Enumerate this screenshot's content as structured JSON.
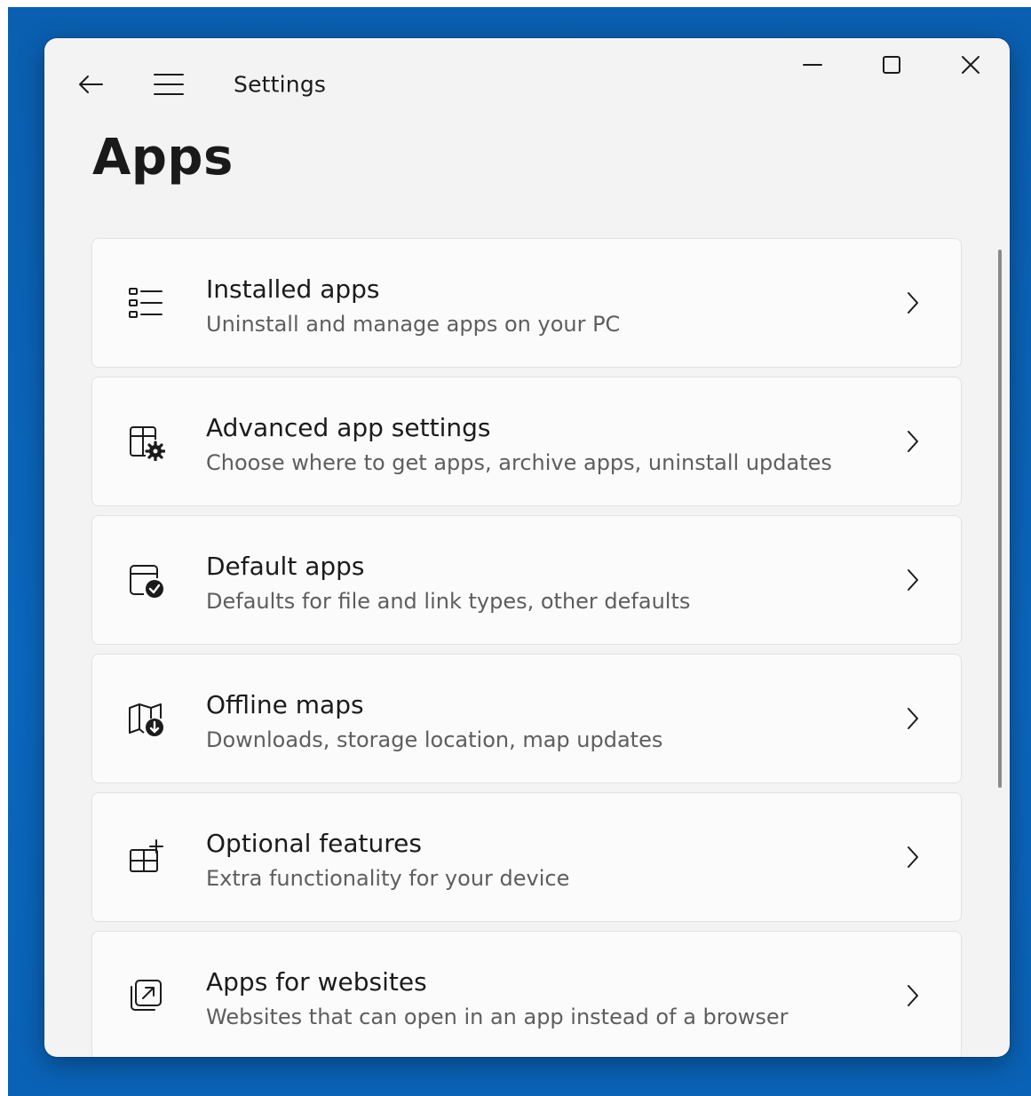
{
  "window": {
    "title": "Settings",
    "back_icon": "back-arrow-icon",
    "menu_icon": "hamburger-menu-icon",
    "minimize_icon": "minimize-icon",
    "maximize_icon": "maximize-icon",
    "close_icon": "close-icon"
  },
  "page": {
    "title": "Apps"
  },
  "items": [
    {
      "icon": "installed-apps-list-icon",
      "title": "Installed apps",
      "description": "Uninstall and manage apps on your PC"
    },
    {
      "icon": "advanced-app-settings-gear-icon",
      "title": "Advanced app settings",
      "description": "Choose where to get apps, archive apps, uninstall updates"
    },
    {
      "icon": "default-apps-check-icon",
      "title": "Default apps",
      "description": "Defaults for file and link types, other defaults"
    },
    {
      "icon": "offline-maps-download-icon",
      "title": "Offline maps",
      "description": "Downloads, storage location, map updates"
    },
    {
      "icon": "optional-features-add-icon",
      "title": "Optional features",
      "description": "Extra functionality for your device"
    },
    {
      "icon": "apps-for-websites-open-icon",
      "title": "Apps for websites",
      "description": "Websites that can open in an app instead of a browser"
    }
  ],
  "colors": {
    "desktop_background": "#0b63b7",
    "window_background": "#f3f3f3",
    "card_background": "#fbfbfb",
    "primary_text": "#1b1b1b",
    "secondary_text": "#5e5e5e"
  }
}
